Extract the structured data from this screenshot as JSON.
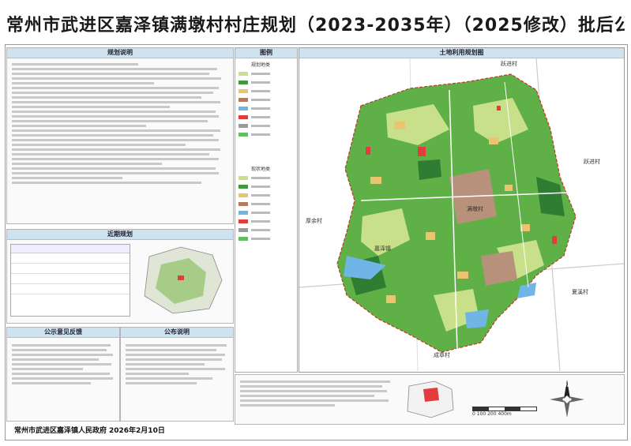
{
  "title": "常州市武进区嘉泽镇满墩村村庄规划（2023-2035年）（2025修改）批后公布",
  "panels": {
    "plan_notes": {
      "heading": "规划说明"
    },
    "legend": {
      "heading": "图例"
    },
    "map": {
      "heading": "土地利用规划图"
    },
    "near_term": {
      "heading": "近期规划"
    },
    "opinions": {
      "heading": "公示意见反馈"
    },
    "announcement": {
      "heading": "公布说明"
    }
  },
  "map_labels": {
    "village_left": "厚余村",
    "village_right": "跃进村",
    "village_bottom": "夏溪村",
    "village_bottom2": "成章村",
    "village_center": "满墩村",
    "road_center": "嘉泽镇",
    "village_top": "跃进村"
  },
  "legend_titles": [
    "规划地类",
    "现状地类"
  ],
  "legend_colors": {
    "farmland": "#c9e08a",
    "forest": "#3f9a3f",
    "rural_residential": "#e8c56e",
    "industrial": "#b47a62",
    "water": "#6fb5e6",
    "public": "#e23c3c",
    "road": "#9a9a9a",
    "green": "#60c060"
  },
  "footer": {
    "institution": "常州市武进区嘉泽镇人民政府",
    "date": "2026年2月10日"
  },
  "compass_label": "N",
  "scale_label": "0 100 200 400m"
}
